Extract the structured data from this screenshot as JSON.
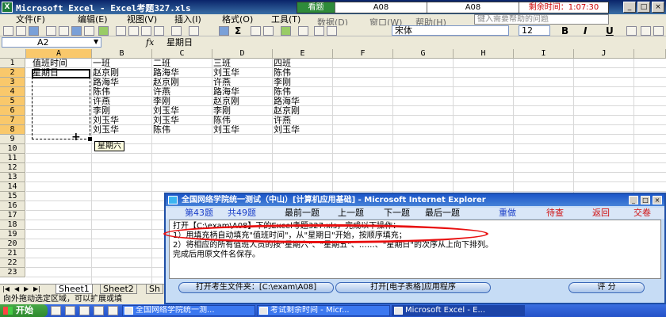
{
  "window": {
    "title": "Microsoft Excel - Excel考题327.xls",
    "app_icon": "X"
  },
  "exam_bar": {
    "status": "看题",
    "exam_code_1": "A08",
    "exam_code_2": "A08",
    "time_label": "剩余时间：",
    "time_value": "1:07:30"
  },
  "menu": {
    "items": [
      "文件(F)",
      "编辑(E)",
      "视图(V)",
      "插入(I)",
      "格式(O)",
      "工具(T)",
      "数据(D)",
      "窗口(W)",
      "帮助(H)"
    ],
    "help_hint": "键入需要帮助的问题"
  },
  "toolbar": {
    "font_name": "宋体",
    "font_size": "12",
    "bold": "B",
    "italic": "I",
    "underline": "U",
    "sigma": "Σ"
  },
  "formula_bar": {
    "name_box": "A2",
    "fx": "fx",
    "value": "星期日"
  },
  "sheet": {
    "columns": [
      "A",
      "B",
      "C",
      "D",
      "E",
      "F",
      "G",
      "H",
      "I",
      "J"
    ],
    "rows": [
      "1",
      "2",
      "3",
      "4",
      "5",
      "6",
      "7",
      "8",
      "9",
      "10",
      "11",
      "12",
      "13",
      "14",
      "15",
      "16",
      "17",
      "18",
      "19",
      "20",
      "21",
      "22",
      "23"
    ],
    "cells": [
      [
        "值班时间",
        "一班",
        "二班",
        "三班",
        "四班"
      ],
      [
        "星期日",
        "赵京刚",
        "路海华",
        "刘玉华",
        "陈伟"
      ],
      [
        "",
        "路海华",
        "赵京刚",
        "许燕",
        "李刚"
      ],
      [
        "",
        "陈伟",
        "许燕",
        "路海华",
        "陈伟"
      ],
      [
        "",
        "许燕",
        "李刚",
        "赵京刚",
        "路海华"
      ],
      [
        "",
        "李刚",
        "刘玉华",
        "李刚",
        "赵京刚"
      ],
      [
        "",
        "刘玉华",
        "刘玉华",
        "陈伟",
        "许燕"
      ],
      [
        "",
        "刘玉华",
        "陈伟",
        "刘玉华",
        "刘玉华"
      ]
    ],
    "fill_tooltip": "星期六",
    "tabs": [
      "Sheet1",
      "Sheet2",
      "Sh"
    ]
  },
  "status_bar": {
    "text": "向外拖动选定区域，可以扩展或填"
  },
  "dialog": {
    "title": "全国网络学院统一测试（中山）[计算机应用基础] - Microsoft Internet Explorer",
    "nav": {
      "question_no": "第43题",
      "total": "共49题",
      "first": "最前一题",
      "prev": "上一题",
      "next": "下一题",
      "last": "最后一题",
      "redo": "重做",
      "review": "待查",
      "back": "返回",
      "submit": "交卷"
    },
    "lines": [
      "打开【C:\\exam\\A08】下的Excel考题327.xls，完成以下操作：",
      "1）用填充柄自动填充\"值班时间\"，从\"星期日\"开始，按顺序填充；",
      "2）将相应的所有值班人员的按\"星期六\"、\"星期五\"、……、\"星期日\"的次序从上向下排列。",
      "完成后用原文件名保存。"
    ],
    "btn_open_folder": "打开考生文件夹：[C:\\exam\\A08]",
    "btn_open_app": "打开[电子表格]应用程序",
    "btn_score": "评 分"
  },
  "taskbar": {
    "start": "开始",
    "tasks": [
      "全国网络学院统一测...",
      "考试剩余时间 - Micr...",
      "Microsoft Excel - E..."
    ]
  }
}
